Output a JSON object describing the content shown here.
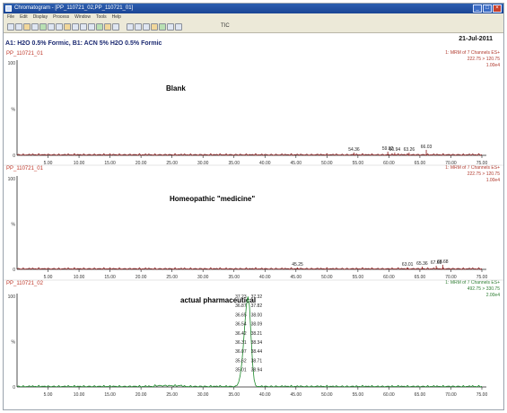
{
  "window": {
    "title": "Chromatogram - [PP_110721_02,PP_110721_01]",
    "icons": [
      "app-icon",
      "minimize-icon",
      "maximize-icon",
      "close-icon"
    ],
    "minimize": "_",
    "maximize": "□",
    "close": "×"
  },
  "menu": [
    "File",
    "Edit",
    "Display",
    "Process",
    "Window",
    "Tools",
    "Help"
  ],
  "toolbar": {
    "icons": [
      "open-icon",
      "print-icon",
      "copy-icon",
      "paste-icon",
      "zoom-icon",
      "undo-icon",
      "redo-icon",
      "peak-icon",
      "integrate-icon",
      "overlay-icon",
      "baseline-icon",
      "smooth-icon",
      "subtract-icon",
      "mass-icon",
      "refresh-icon",
      "settings-icon",
      "axis-icon",
      "label-icon",
      "info-icon",
      "grid-icon",
      "scale-icon"
    ],
    "eq_label": "TIC"
  },
  "header": {
    "method": "A1: H2O 0.5% Formic, B1: ACN 5% H2O 0.5% Formic",
    "date": "21-Jul-2011"
  },
  "colors": {
    "blank_trace": "#8b1a1a",
    "sample_trace": "#1b8a2a",
    "axis": "#222222"
  },
  "chart_data": [
    {
      "type": "line",
      "name": "PP_110721_01",
      "annotation": "Blank",
      "channel": "1: MRM of 7 Channels ES+",
      "transition": "222.75 > 120.75",
      "intensity": "1.00e4",
      "xlim": [
        0,
        75
      ],
      "ylim": [
        0,
        100
      ],
      "x_ticks": [
        "5.00",
        "10.00",
        "15.00",
        "20.00",
        "25.00",
        "30.00",
        "35.00",
        "40.00",
        "45.00",
        "50.00",
        "55.00",
        "60.00",
        "65.00",
        "70.00",
        "75.00"
      ],
      "y_ticks": [
        "0",
        "%",
        "100"
      ],
      "peaks": [
        {
          "x": 54.36,
          "label": "54.36",
          "y": 3
        },
        {
          "x": 59.82,
          "label": "59.82",
          "y": 4
        },
        {
          "x": 60.94,
          "label": "60.94",
          "y": 3
        },
        {
          "x": 63.26,
          "label": "63.26",
          "y": 3
        },
        {
          "x": 66.03,
          "label": "66.03",
          "y": 6
        }
      ]
    },
    {
      "type": "line",
      "name": "PP_110721_01",
      "annotation": "Homeopathic \"medicine\"",
      "channel": "1: MRM of 7 Channels ES+",
      "transition": "222.75 > 120.75",
      "intensity": "1.00e4",
      "xlim": [
        0,
        75
      ],
      "ylim": [
        0,
        100
      ],
      "x_ticks": [
        "5.00",
        "10.00",
        "15.00",
        "20.00",
        "25.00",
        "30.00",
        "35.00",
        "40.00",
        "45.00",
        "50.00",
        "55.00",
        "60.00",
        "65.00",
        "70.00",
        "75.00"
      ],
      "y_ticks": [
        "0",
        "%",
        "100"
      ],
      "peaks": [
        {
          "x": 45.25,
          "label": "45.25",
          "y": 2
        },
        {
          "x": 63.01,
          "label": "63.01",
          "y": 2
        },
        {
          "x": 65.36,
          "label": "65.36",
          "y": 3
        },
        {
          "x": 67.63,
          "label": "67.63",
          "y": 4
        },
        {
          "x": 68.68,
          "label": "68.68",
          "y": 5
        }
      ]
    },
    {
      "type": "line",
      "name": "PP_110721_02",
      "annotation": "actual pharmaceutical",
      "channel": "1: MRM of 7 Channels ES+",
      "transition": "492.75 > 330.75",
      "intensity": "2.00e4",
      "xlim": [
        0,
        75
      ],
      "ylim": [
        0,
        100
      ],
      "x_ticks": [
        "5.00",
        "10.00",
        "15.00",
        "20.00",
        "25.00",
        "30.00",
        "35.00",
        "40.00",
        "45.00",
        "50.00",
        "55.00",
        "60.00",
        "65.00",
        "70.00",
        "75.00"
      ],
      "y_ticks": [
        "0",
        "%",
        "100"
      ],
      "peak_labels_left": [
        "37.23",
        "36.87",
        "36.65",
        "36.54",
        "36.42",
        "36.31",
        "36.07",
        "35.62",
        "35.01"
      ],
      "peak_labels_right": [
        "37.32",
        "37.82",
        "38.00",
        "38.09",
        "38.21",
        "38.34",
        "38.44",
        "38.71",
        "38.94"
      ],
      "peak_apex": {
        "x": 37.3,
        "y": 100
      }
    }
  ]
}
